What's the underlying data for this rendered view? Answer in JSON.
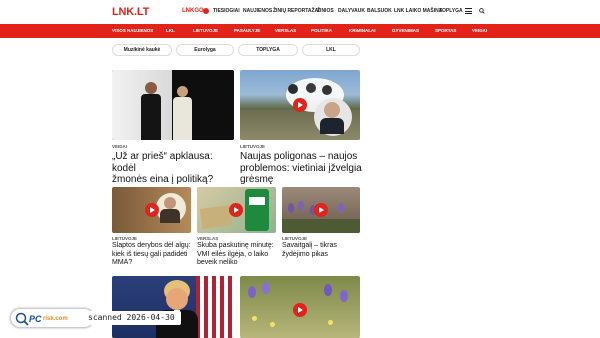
{
  "header": {
    "logo": "LNK.LT",
    "lnkgo": "LNKGO",
    "nav": [
      "TIESIOGIAI",
      "NAUJIENOS",
      "ŽINIŲ REPORTAŽAI",
      "ŽINIOS",
      "DALYVAUK",
      "BALSUOK",
      "LNK LAIKO MAŠINA",
      "TOPLYGA"
    ]
  },
  "category_nav": [
    "VISOS NAUJIENOS",
    "LKL",
    "LIETUVOJE",
    "PASAULYJE",
    "VERSLAS",
    "POLITIKA",
    "KRIMINALAI",
    "GYVENIMAS",
    "SPORTAS",
    "VEIDAI"
  ],
  "tags": [
    "Muzikinė kaukė",
    "Eurolyga",
    "TOPLYGA",
    "LKL"
  ],
  "articles": {
    "big1": {
      "category": "VEIDAI",
      "title_line1": "„Už ar prieš“ apklausa: kodėl",
      "title_line2": "žmonės eina į politiką?"
    },
    "big2": {
      "category": "LIETUVOJE",
      "title_line1": "Naujas poligonas – naujos",
      "title_line2": "problemos: vietiniai įžvelgia",
      "title_line3": "grėsmę"
    },
    "small1": {
      "category": "LIETUVOJE",
      "title_line1": "Slaptos derybos dėl algų:",
      "title_line2": "kiek iš tiesų gali padidėti",
      "title_line3": "MMA?"
    },
    "small2": {
      "category": "VERSLAS",
      "title_line1": "Skuba paskutinę minutę:",
      "title_line2": "VMI eilės ilgėja, o laiko",
      "title_line3": "beveik neliko"
    },
    "small3": {
      "category": "LIETUVOJE",
      "title_line1": "Savaitgalį – tikras",
      "title_line2": "žydėjimo pikas"
    }
  },
  "watermark": {
    "brand_pc": "PC",
    "brand_risk": "risk.com",
    "scanned": "scanned 2026-04-30"
  },
  "colors": {
    "brand_red": "#e2231a",
    "nav_text": "#ffffff"
  }
}
